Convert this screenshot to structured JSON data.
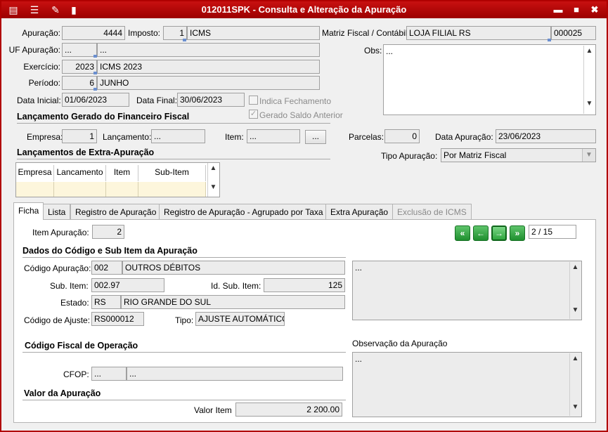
{
  "window": {
    "title": "012011SPK - Consulta e Alteração da Apuração",
    "minimize": "▬",
    "maximize": "■",
    "close": "✖"
  },
  "header": {
    "apuracao_label": "Apuração:",
    "apuracao_value": "4444",
    "imposto_label": "Imposto:",
    "imposto_code": "1",
    "imposto_name": "ICMS",
    "matriz_label": "Matriz Fiscal / Contábil:",
    "matriz_name": "LOJA FILIAL RS",
    "matriz_code": "000025",
    "uf_label": "UF Apuração:",
    "uf_code": "...",
    "uf_name": "...",
    "obs_label": "Obs:",
    "obs_value": "...",
    "exercicio_label": "Exercício:",
    "exercicio_code": "2023",
    "exercicio_name": "ICMS 2023",
    "periodo_label": "Período:",
    "periodo_code": "6",
    "periodo_name": "JUNHO",
    "data_inicial_label": "Data Inicial:",
    "data_inicial_value": "01/06/2023",
    "data_final_label": "Data Final:",
    "data_final_value": "30/06/2023",
    "indica_fechamento": "Indica Fechamento",
    "gerado_saldo": "Gerado Saldo Anterior",
    "gerado_saldo_checked": true
  },
  "financeiro": {
    "section": "Lançamento Gerado do Financeiro Fiscal",
    "empresa_label": "Empresa:",
    "empresa_value": "1",
    "lancamento_label": "Lançamento:",
    "lancamento_value": "...",
    "item_label": "Item:",
    "item_value": "...",
    "browse_button": "...",
    "parcelas_label": "Parcelas:",
    "parcelas_value": "0",
    "data_apuracao_label": "Data Apuração:",
    "data_apuracao_value": "23/06/2023",
    "tipo_apuracao_label": "Tipo Apuração:",
    "tipo_apuracao_value": "Por Matriz Fiscal"
  },
  "extra": {
    "section": "Lançamentos de Extra-Apuração",
    "columns": [
      "Empresa",
      "Lancamento",
      "Item",
      "Sub-Item"
    ]
  },
  "tabs": [
    {
      "label": "Ficha"
    },
    {
      "label": "Lista"
    },
    {
      "label": "Registro de Apuração"
    },
    {
      "label": "Registro de Apuração - Agrupado por Taxa"
    },
    {
      "label": "Extra Apuração"
    },
    {
      "label": "Exclusão de ICMS"
    }
  ],
  "ficha": {
    "item_apuracao_label": "Item Apuração:",
    "item_apuracao_value": "2",
    "page_indicator": "2 / 15",
    "dados_section": "Dados do Código e Sub Item da Apuração",
    "codigo_apuracao_label": "Código Apuração:",
    "codigo_apuracao_code": "002",
    "codigo_apuracao_desc": "OUTROS DÉBITOS",
    "sub_item_label": "Sub. Item:",
    "sub_item_value": "002.97",
    "id_sub_item_label": "Id. Sub. Item:",
    "id_sub_item_value": "125",
    "estado_label": "Estado:",
    "estado_code": "RS",
    "estado_name": "RIO GRANDE DO SUL",
    "codigo_ajuste_label": "Código de Ajuste:",
    "codigo_ajuste_value": "RS000012",
    "tipo_label": "Tipo:",
    "tipo_value": "AJUSTE AUTOMÁTICO",
    "desc_memo": "...",
    "cfop_section": "Código Fiscal de Operação",
    "cfop_label": "CFOP:",
    "cfop_code": "...",
    "cfop_desc": "...",
    "obs_apuracao_label": "Observação da Apuração",
    "obs_apuracao_value": "...",
    "valor_section": "Valor da Apuração",
    "valor_item_label": "Valor Item",
    "valor_item_value": "2 200.00"
  },
  "colors": {
    "title_bar": "#b00000",
    "nav_green": "#2aa33a"
  }
}
